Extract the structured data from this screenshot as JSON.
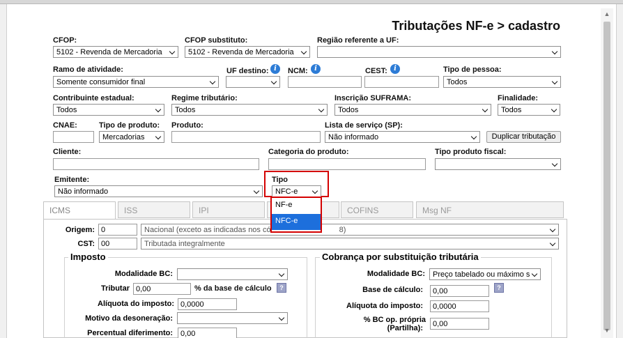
{
  "page": {
    "title": "Tributações NF-e > cadastro"
  },
  "row1": {
    "cfop": {
      "label": "CFOP:",
      "value": "5102 - Revenda de Mercadoria"
    },
    "cfop_substituto": {
      "label": "CFOP substituto:",
      "value": "5102 - Revenda de Mercadoria"
    },
    "regiao_uf": {
      "label": "Região referente a UF:",
      "value": ""
    }
  },
  "row2": {
    "ramo": {
      "label": "Ramo de atividade:",
      "value": "Somente consumidor final"
    },
    "uf_destino": {
      "label": "UF destino:",
      "value": ""
    },
    "ncm": {
      "label": "NCM:",
      "value": ""
    },
    "cest": {
      "label": "CEST:",
      "value": ""
    },
    "tipo_pessoa": {
      "label": "Tipo de pessoa:",
      "value": "Todos"
    }
  },
  "row3": {
    "contribuinte": {
      "label": "Contribuinte estadual:",
      "value": "Todos"
    },
    "regime": {
      "label": "Regime tributário:",
      "value": "Todos"
    },
    "suframa": {
      "label": "Inscrição SUFRAMA:",
      "value": "Todos"
    },
    "finalidade": {
      "label": "Finalidade:",
      "value": "Todos"
    }
  },
  "row4": {
    "cnae": {
      "label": "CNAE:",
      "value": ""
    },
    "tipo_produto": {
      "label": "Tipo de produto:",
      "value": "Mercadorias"
    },
    "produto": {
      "label": "Produto:",
      "value": ""
    },
    "lista_servico": {
      "label": "Lista de serviço (SP):",
      "value": "Não informado"
    },
    "duplicar_button": "Duplicar tributação"
  },
  "row5": {
    "cliente": {
      "label": "Cliente:",
      "value": ""
    },
    "categoria": {
      "label": "Categoria do produto:",
      "value": ""
    },
    "tipo_fiscal": {
      "label": "Tipo produto fiscal:",
      "value": ""
    }
  },
  "row6": {
    "emitente": {
      "label": "Emitente:",
      "value": "Não informado"
    },
    "tipo": {
      "label": "Tipo",
      "value": "NFC-e",
      "options": [
        "NF-e",
        "NFC-e"
      ],
      "highlighted": "NFC-e"
    }
  },
  "tabs": [
    "ICMS",
    "ISS",
    "IPI",
    "COFINS",
    "Msg NF"
  ],
  "icms": {
    "origem": {
      "label": "Origem:",
      "code": "0",
      "text": "Nacional (exceto as indicadas nos có",
      "text_tail": "8)"
    },
    "cst": {
      "label": "CST:",
      "code": "00",
      "text": "Tributada integralmente"
    },
    "imposto": {
      "legend": "Imposto",
      "modalidade_bc": {
        "label": "Modalidade BC:",
        "value": ""
      },
      "tributar": {
        "label": "Tributar",
        "value": "0,00",
        "suffix": "% da base de cálculo"
      },
      "aliquota": {
        "label": "Alíquota do imposto:",
        "value": "0,0000"
      },
      "motivo": {
        "label": "Motivo da desoneração:",
        "value": ""
      },
      "percentual": {
        "label": "Percentual diferimento:",
        "value": "0,00"
      }
    },
    "st": {
      "legend": "Cobrança por substituição tributária",
      "modalidade_bc": {
        "label": "Modalidade BC:",
        "value": "Preço tabelado ou máximo s"
      },
      "base_calculo": {
        "label": "Base de cálculo:",
        "value": "0,00"
      },
      "aliquota": {
        "label": "Alíquota do imposto:",
        "value": "0,0000"
      },
      "bc_op_propria": {
        "label": "% BC op. própria",
        "label2": "(Partilha):",
        "value": "0,00"
      }
    }
  },
  "colors": {
    "accent": "#1d6fdc",
    "highlight_border": "#d40000",
    "info_icon": "#2d7cd6"
  }
}
